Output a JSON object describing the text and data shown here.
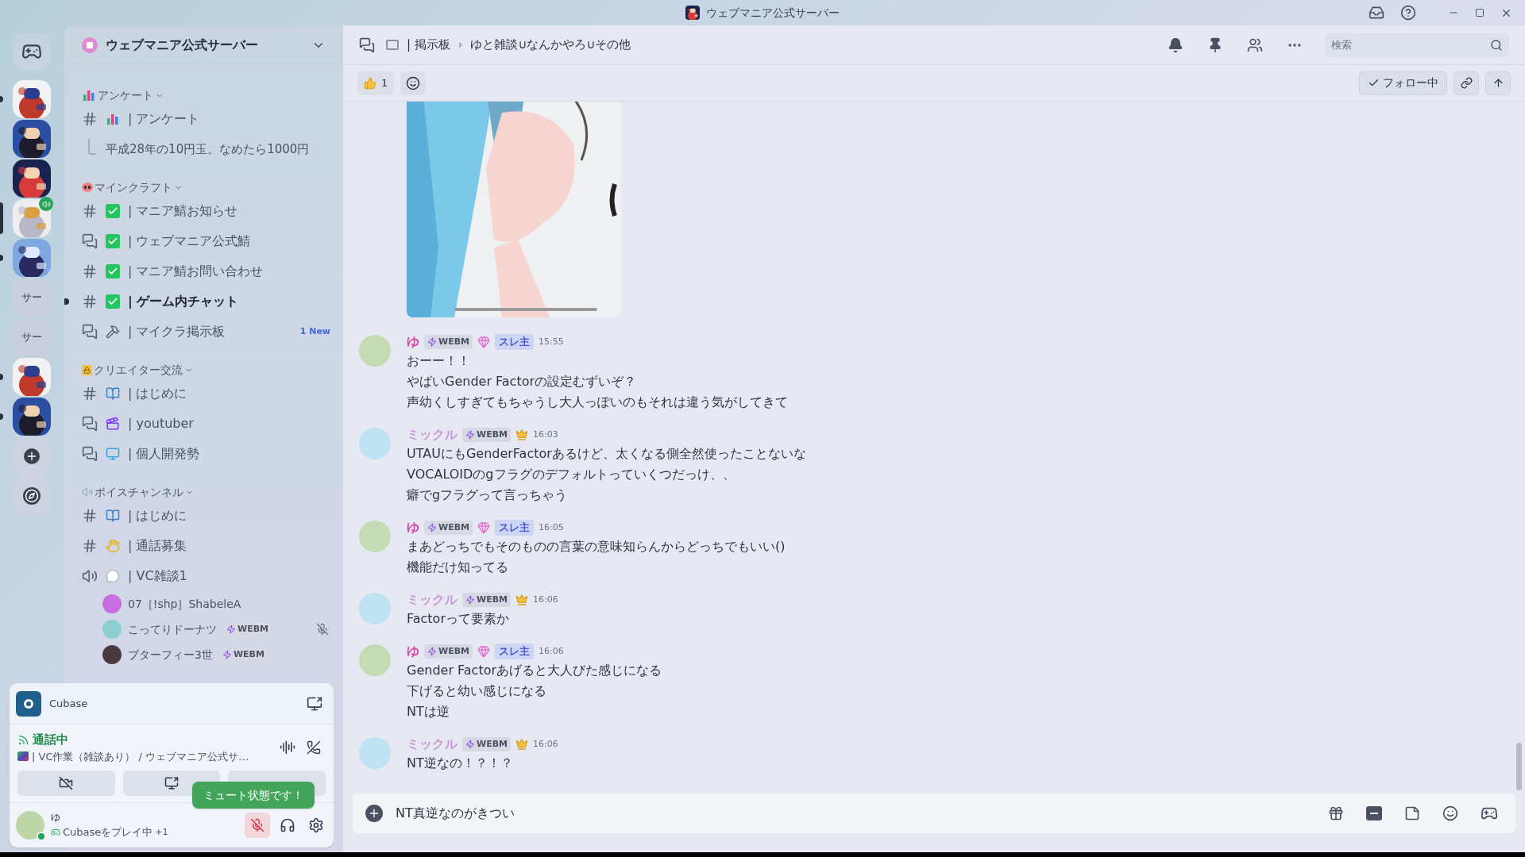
{
  "window": {
    "title": "ウェブマニア公式サーバー"
  },
  "server_rail": [
    {
      "kind": "logo",
      "selected": false,
      "unread": false,
      "in_voice": false
    },
    {
      "kind": "picture",
      "selected": false,
      "unread": true,
      "in_voice": false
    },
    {
      "kind": "picture",
      "selected": false,
      "unread": false,
      "in_voice": false
    },
    {
      "kind": "picture",
      "selected": false,
      "unread": false,
      "in_voice": false
    },
    {
      "kind": "picture",
      "selected": true,
      "unread": false,
      "in_voice": true
    },
    {
      "kind": "picture",
      "selected": false,
      "unread": true,
      "in_voice": false
    },
    {
      "kind": "text",
      "label": "サー",
      "selected": false,
      "unread": false,
      "in_voice": false
    },
    {
      "kind": "text",
      "label": "サー",
      "selected": false,
      "unread": false,
      "in_voice": false
    },
    {
      "kind": "picture",
      "selected": false,
      "unread": true,
      "in_voice": false
    },
    {
      "kind": "picture",
      "selected": false,
      "unread": true,
      "in_voice": false
    },
    {
      "kind": "add",
      "selected": false,
      "unread": false,
      "in_voice": false
    },
    {
      "kind": "discover",
      "selected": false,
      "unread": false,
      "in_voice": false
    }
  ],
  "sidebar": {
    "server_name": "ウェブマニア公式サーバー",
    "categories": [
      {
        "name": "アンケート",
        "channels": [
          {
            "kind": "text",
            "name": "| アンケート",
            "unread": false,
            "threads": [
              {
                "name": "平成28年の10円玉。なめたら1000円"
              }
            ]
          }
        ]
      },
      {
        "name": "マインクラフト",
        "channels": [
          {
            "kind": "text",
            "name": "| マニア鯖お知らせ",
            "unread": false
          },
          {
            "kind": "forum",
            "name": "| ウェブマニア公式鯖",
            "unread": false
          },
          {
            "kind": "text",
            "name": "| マニア鯖お問い合わせ",
            "unread": false
          },
          {
            "kind": "text",
            "name": "| ゲーム内チャット",
            "unread": true
          },
          {
            "kind": "forum",
            "name": "| マイクラ掲示板",
            "unread": false,
            "badge": "1 New"
          }
        ]
      },
      {
        "name": "クリエイター交流",
        "channels": [
          {
            "kind": "text",
            "name": "| はじめに",
            "unread": false
          },
          {
            "kind": "forum",
            "name": "| youtuber",
            "unread": false
          },
          {
            "kind": "forum",
            "name": "| 個人開発勢",
            "unread": false
          }
        ]
      },
      {
        "name": "ボイスチャンネル",
        "channels": [
          {
            "kind": "text",
            "name": "| はじめに",
            "unread": false
          },
          {
            "kind": "text",
            "name": "| 通話募集",
            "unread": false
          },
          {
            "kind": "voice",
            "name": "| VC雑談1",
            "unread": false,
            "members": [
              {
                "name": "07［!shp］ShabeleA",
                "muted": false
              },
              {
                "name": "こってりドーナツ",
                "tag": "WEBM",
                "muted": true
              },
              {
                "name": "ブターフィー3世",
                "tag": "WEBM",
                "muted": false
              }
            ]
          }
        ]
      }
    ]
  },
  "voice_panel": {
    "activity": "Cubase",
    "status": "通話中",
    "channel": "| VC作業（雑談あり） / ウェブマニア公式サ…",
    "tooltip": "ミュート状態です！"
  },
  "user": {
    "name": "ゆ",
    "activity": "Cubaseをプレイ中",
    "extra": "+1",
    "muted": true,
    "online": true
  },
  "header": {
    "channel": "| 掲示板",
    "separator": "›",
    "thread": "ゆと雑談∪なんかやろ∪その他",
    "search": {
      "placeholder": "検索"
    }
  },
  "thread_bar": {
    "reactions": [
      {
        "count": "1"
      }
    ],
    "follow": {
      "label": "フォロー中",
      "following": true
    }
  },
  "messages": [
    {
      "author": "ゆ",
      "kind": "op",
      "color": "#d946a8",
      "tag": "WEBM",
      "op_label": "スレ主",
      "time": "15:55",
      "lines": [
        "おーー！！",
        "やばいGender Factorの設定むずいぞ？",
        "声幼くしすぎてもちゃうし大人っぽいのもそれは違う気がしてきて"
      ]
    },
    {
      "author": "ミックル",
      "kind": "member",
      "color": "#c89ad8",
      "tag": "WEBM",
      "time": "16:03",
      "lines": [
        "UTAUにもGenderFactorあるけど、太くなる側全然使ったことないな",
        "VOCALOIDのgフラグのデフォルトっていくつだっけ、、",
        "癖でgフラグって言っちゃう"
      ]
    },
    {
      "author": "ゆ",
      "kind": "op",
      "color": "#d946a8",
      "tag": "WEBM",
      "op_label": "スレ主",
      "time": "16:05",
      "lines": [
        "まあどっちでもそのものの言葉の意味知らんからどっちでもいい()",
        "機能だけ知ってる"
      ]
    },
    {
      "author": "ミックル",
      "kind": "member",
      "color": "#c89ad8",
      "tag": "WEBM",
      "time": "16:06",
      "lines": [
        "Factorって要素か"
      ]
    },
    {
      "author": "ゆ",
      "kind": "op",
      "color": "#d946a8",
      "tag": "WEBM",
      "op_label": "スレ主",
      "time": "16:06",
      "lines": [
        "Gender Factorあげると大人びた感じになる",
        "下げると幼い感じになる",
        "NTは逆"
      ]
    },
    {
      "author": "ミックル",
      "kind": "member",
      "color": "#c89ad8",
      "tag": "WEBM",
      "time": "16:06",
      "lines": [
        "NT逆なの！？！？"
      ]
    }
  ],
  "composer": {
    "value": "NT真逆なのがきつい"
  }
}
